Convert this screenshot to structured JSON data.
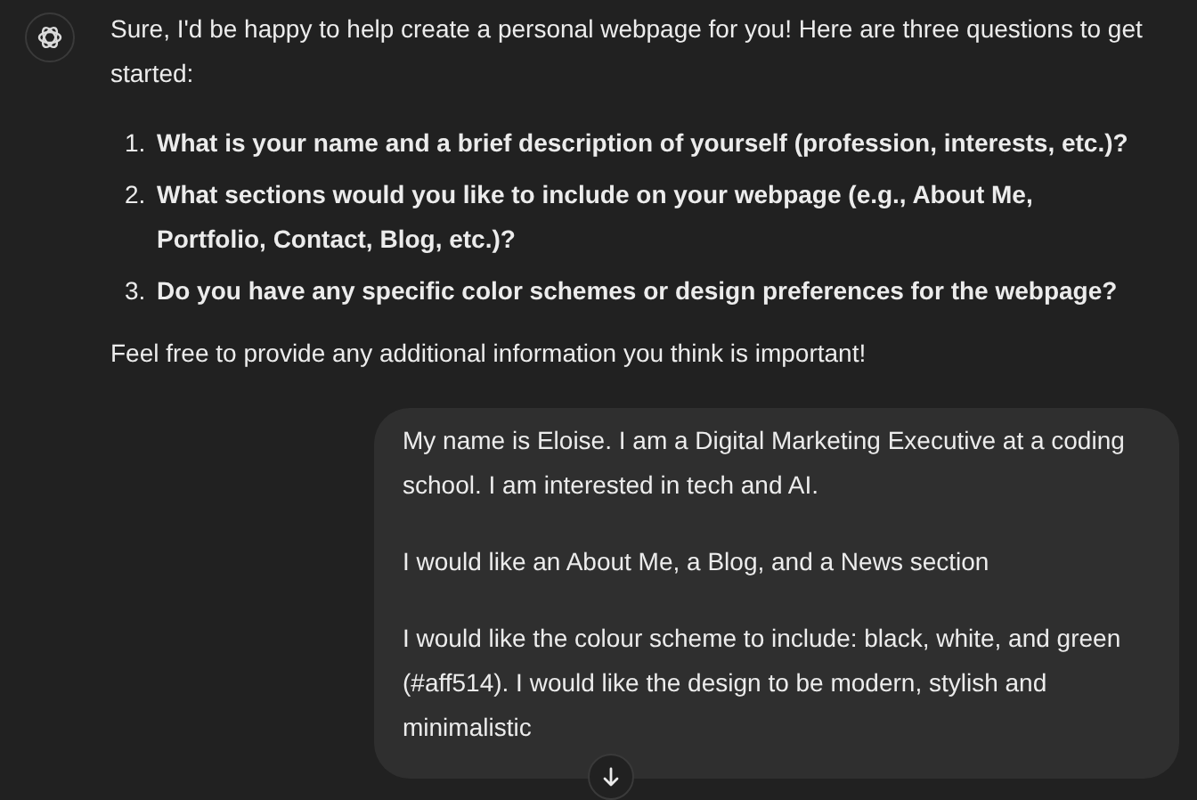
{
  "assistant_message": {
    "intro": "Sure, I'd be happy to help create a personal webpage for you! Here are three questions to get started:",
    "questions": [
      {
        "number": "1.",
        "text": "What is your name and a brief description of yourself (profession, interests, etc.)?"
      },
      {
        "number": "2.",
        "text": "What sections would you like to include on your webpage (e.g., About Me, Portfolio, Contact, Blog, etc.)?"
      },
      {
        "number": "3.",
        "text": "Do you have any specific color schemes or design preferences for the webpage?"
      }
    ],
    "closing": "Feel free to provide any additional information you think is important!"
  },
  "user_message": {
    "paragraphs": [
      "My name is Eloise. I am a Digital Marketing Executive at a coding school. I am interested in tech and AI.",
      "I would like an About Me, a Blog, and a News section",
      "I would like the colour scheme to include: black, white, and green (#aff514). I would like the design to be modern, stylish and minimalistic"
    ]
  }
}
